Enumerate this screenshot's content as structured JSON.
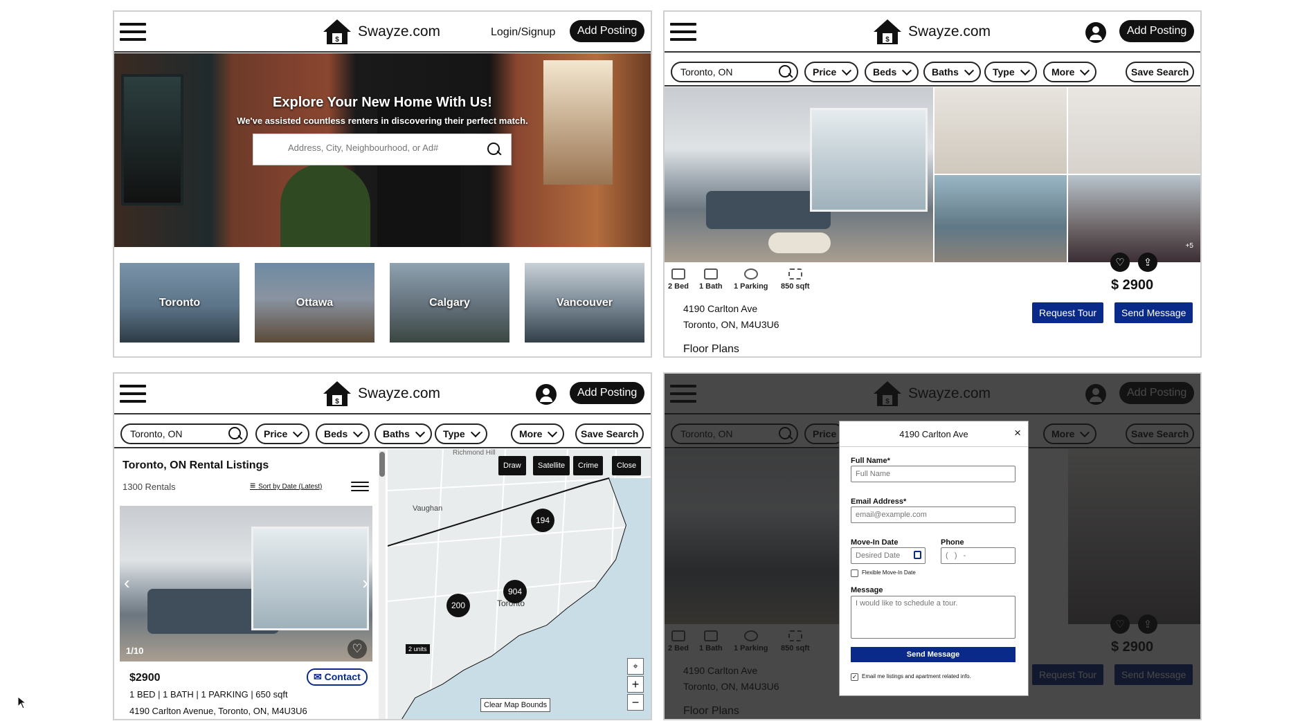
{
  "brand": {
    "name": "Swayze.com"
  },
  "home": {
    "login_label": "Login/Signup",
    "add_posting_label": "Add Posting",
    "hero_title": "Explore Your New Home With Us!",
    "hero_subtitle": "We've assisted countless renters in discovering their perfect match.",
    "search_placeholder": "Address, City, Neighbourhood, or Ad#",
    "cities": [
      "Toronto",
      "Ottawa",
      "Calgary",
      "Vancouver"
    ]
  },
  "detail": {
    "add_posting_label": "Add Posting",
    "location": "Toronto, ON",
    "filters": [
      "Price",
      "Beds",
      "Baths",
      "Type",
      "More"
    ],
    "save_search_label": "Save Search",
    "more_photos": "+5",
    "amenities": [
      "2 Bed",
      "1 Bath",
      "1 Parking",
      "850 sqft"
    ],
    "price": "$ 2900",
    "address_line1": "4190 Carlton Ave",
    "address_line2": "Toronto, ON, M4U3U6",
    "request_tour_label": "Request Tour",
    "send_message_label": "Send Message",
    "floor_plans_label": "Floor Plans"
  },
  "listings": {
    "add_posting_label": "Add Posting",
    "location": "Toronto, ON",
    "filters": [
      "Price",
      "Beds",
      "Baths",
      "Type",
      "More"
    ],
    "save_search_label": "Save Search",
    "heading": "Toronto, ON Rental Listings",
    "count": "1300 Rentals",
    "sort_label": "Sort by Date (Latest)",
    "photo_counter": "1/10",
    "price": "$2900",
    "contact_label": "Contact",
    "specs": "1 BED | 1 BATH | 1 PARKING | 650 sqft",
    "address": "4190 Carlton Avenue, Toronto, ON, M4U3U6",
    "map": {
      "buttons": [
        "Draw",
        "Satellite",
        "Crime",
        "Close"
      ],
      "labels": [
        "Richmond Hill",
        "Vaughan",
        "Toronto"
      ],
      "clusters": [
        "194",
        "904",
        "200"
      ],
      "units_tag": "2 units",
      "clear_bounds_label": "Clear Map Bounds",
      "zoom_in": "+",
      "zoom_out": "−"
    }
  },
  "modal": {
    "title": "4190 Carlton Ave",
    "close": "×",
    "full_name_label": "Full Name*",
    "full_name_placeholder": "Full Name",
    "email_label": "Email Address*",
    "email_placeholder": "email@example.com",
    "move_in_label": "Move-In Date",
    "move_in_placeholder": "Desired Date",
    "phone_label": "Phone",
    "phone_placeholder": "(   )   -",
    "flexible_label": "Flexible Move-In Date",
    "message_label": "Message",
    "message_placeholder": "I would like to schedule a tour.",
    "send_label": "Send Message",
    "consent_label": "Email me listings and apartment related info."
  },
  "colors": {
    "accent_blue": "#0a2a8a",
    "black": "#111111"
  }
}
